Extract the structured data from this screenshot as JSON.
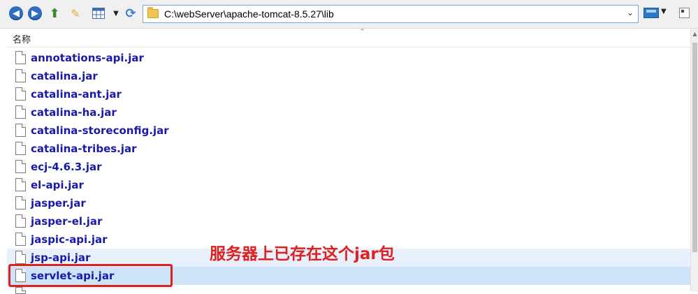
{
  "toolbar": {
    "address_path": "C:\\webServer\\apache-tomcat-8.5.27\\lib"
  },
  "list": {
    "column_header": "名称",
    "files": [
      {
        "name": "annotations-api.jar"
      },
      {
        "name": "catalina.jar"
      },
      {
        "name": "catalina-ant.jar"
      },
      {
        "name": "catalina-ha.jar"
      },
      {
        "name": "catalina-storeconfig.jar"
      },
      {
        "name": "catalina-tribes.jar"
      },
      {
        "name": "ecj-4.6.3.jar"
      },
      {
        "name": "el-api.jar"
      },
      {
        "name": "jasper.jar"
      },
      {
        "name": "jasper-el.jar"
      },
      {
        "name": "jaspic-api.jar"
      },
      {
        "name": "jsp-api.jar"
      },
      {
        "name": "servlet-api.jar"
      }
    ],
    "selected_file": "servlet-api.jar"
  },
  "annotation": {
    "text": "服务器上已存在这个jar包",
    "color": "#e02020"
  },
  "colors": {
    "file_name": "#1a1aa6",
    "selection": "#cde3f7",
    "hover": "#e8f1fb"
  }
}
